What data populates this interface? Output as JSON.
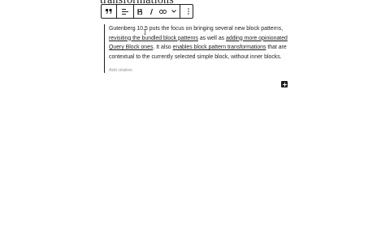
{
  "editor": {
    "heading_fragment": "transformations"
  },
  "toolbar": {
    "buttons": [
      "quote-icon",
      "align-icon",
      "bold-icon",
      "italic-icon",
      "link-icon",
      "chevron-down-icon",
      "more-options-icon"
    ]
  },
  "quote": {
    "text_1": "Gutenberg 10.5 puts the focus on bringing several new block patterns, ",
    "link_1": "revisiting the bundled block patterns",
    "text_2": " as well as ",
    "link_2": "adding more opinionated Query Block ones",
    "text_3": ". It also ",
    "link_3": "enables block pattern transformations",
    "text_4": " that are contextual to the currently selected simple block, without inner blocks.",
    "citation_placeholder": "Add citation"
  },
  "colors": {
    "text": "#1e1e1e",
    "placeholder": "#949494"
  }
}
